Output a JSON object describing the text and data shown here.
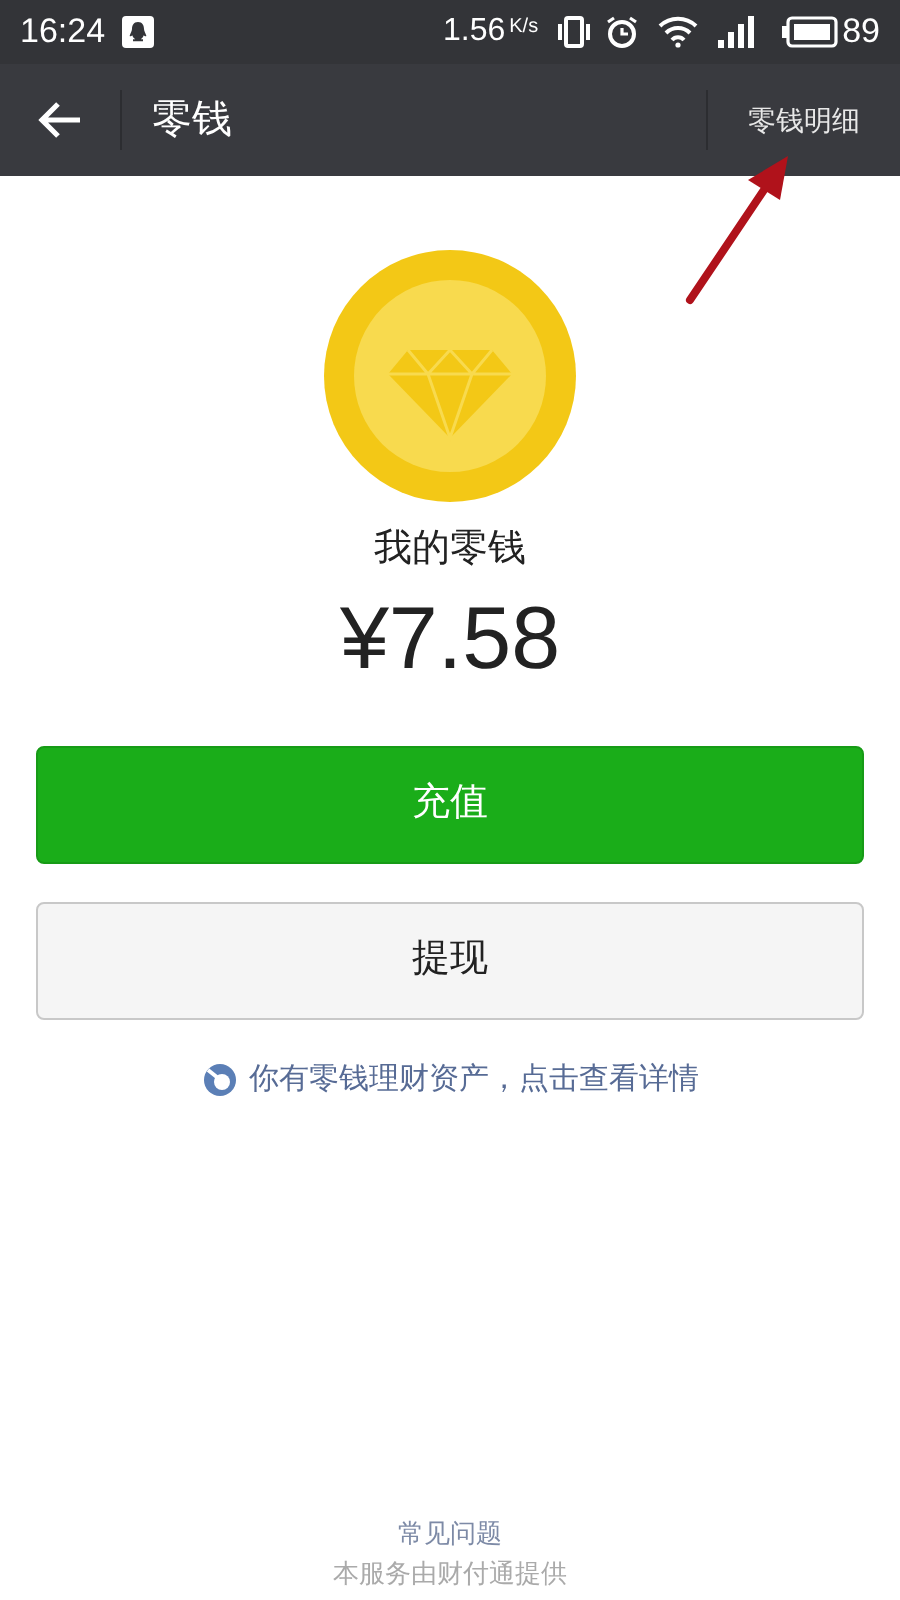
{
  "status_bar": {
    "time": "16:24",
    "speed": "1.56",
    "speed_unit": "K/s",
    "battery": "89"
  },
  "nav_bar": {
    "title": "零钱",
    "action": "零钱明细"
  },
  "balance": {
    "label": "我的零钱",
    "amount": "¥7.58"
  },
  "buttons": [
    {
      "label": "充值",
      "kind": "primary"
    },
    {
      "label": "提现",
      "kind": "default"
    }
  ],
  "notice": "你有零钱理财资产，点击查看详情",
  "footer": {
    "link": "常见问题",
    "note": "本服务由财付通提供"
  }
}
